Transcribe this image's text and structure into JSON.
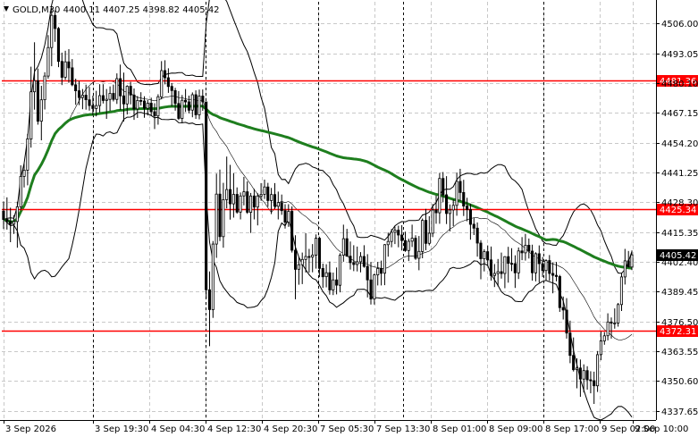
{
  "chart_data": {
    "type": "candlestick",
    "title": "GOLD,M30 4400.11 4407.25 4398.82 4405.42",
    "symbol": "GOLD",
    "timeframe": "M30",
    "last_bar": {
      "open": 4400.11,
      "high": 4407.25,
      "low": 4398.82,
      "close": 4405.42
    },
    "current_price_label": "4405.42",
    "ylim": [
      4333.6,
      4515.4
    ],
    "y_ticks": [
      "4506.00",
      "4493.05",
      "4480.10",
      "4467.15",
      "4454.20",
      "4441.25",
      "4428.30",
      "4415.35",
      "4402.40",
      "4389.45",
      "4376.50",
      "4363.55",
      "4350.60",
      "4337.65"
    ],
    "x_ticks": [
      "3 Sep 2026",
      "3 Sep 19:30",
      "4 Sep 04:30",
      "4 Sep 12:30",
      "4 Sep 20:30",
      "7 Sep 05:30",
      "7 Sep 13:30",
      "8 Sep 01:00",
      "8 Sep 09:00",
      "8 Sep 17:00",
      "9 Sep 02:00",
      "9 Sep 10:00"
    ],
    "levels": [
      {
        "value": 4481.36,
        "label": "4481.36",
        "color": "#ff0000"
      },
      {
        "value": 4425.34,
        "label": "4425.34",
        "color": "#ff0000"
      },
      {
        "value": 4372.31,
        "label": "4372.31",
        "color": "#ff0000"
      }
    ],
    "candles": [
      [
        4424.4,
        4428.6,
        4416.6,
        4420.8
      ],
      [
        4420.8,
        4430.4,
        4416.4,
        4419.9
      ],
      [
        4419.9,
        4425.9,
        4410.9,
        4418.7
      ],
      [
        4418.7,
        4422.6,
        4414.5,
        4419.9
      ],
      [
        4419.9,
        4428.5,
        4408.5,
        4426.3
      ],
      [
        4426.3,
        4444.3,
        4425.0,
        4439.5
      ],
      [
        4439.5,
        4445.3,
        4434.7,
        4442.2
      ],
      [
        4442.2,
        4458.0,
        4435.6,
        4455.8
      ],
      [
        4455.8,
        4487.2,
        4452.0,
        4476.3
      ],
      [
        4476.3,
        4497.8,
        4468.5,
        4481.1
      ],
      [
        4481.1,
        4486.4,
        4462.0,
        4463.5
      ],
      [
        4463.5,
        4478.9,
        4455.2,
        4472.8
      ],
      [
        4472.8,
        4484.8,
        4468.6,
        4483.1
      ],
      [
        4483.1,
        4500.9,
        4482.0,
        4495.5
      ],
      [
        4495.5,
        4512.6,
        4487.4,
        4509.5
      ],
      [
        4509.5,
        4511.6,
        4498.0,
        4503.8
      ],
      [
        4503.8,
        4504.4,
        4487.0,
        4489.5
      ],
      [
        4489.5,
        4493.3,
        4479.2,
        4482.6
      ],
      [
        4482.6,
        4494.1,
        4481.5,
        4489.3
      ],
      [
        4489.3,
        4494.8,
        4480.2,
        4486.7
      ],
      [
        4486.7,
        4490.5,
        4478.7,
        4479.3
      ],
      [
        4479.3,
        4482.0,
        4470.6,
        4476.7
      ],
      [
        4476.7,
        4480.9,
        4470.5,
        4473.8
      ],
      [
        4473.8,
        4477.5,
        4468.7,
        4474.8
      ],
      [
        4474.8,
        4479.4,
        4468.5,
        4472.8
      ],
      [
        4472.8,
        4478.4,
        4468.1,
        4470.3
      ],
      [
        4470.3,
        4474.6,
        4466.1,
        4469.0
      ],
      [
        4469.0,
        4476.7,
        4465.6,
        4470.3
      ],
      [
        4470.3,
        4479.6,
        4467.3,
        4474.6
      ],
      [
        4474.6,
        4479.6,
        4471.2,
        4472.5
      ],
      [
        4472.5,
        4477.5,
        4464.5,
        4473.0
      ],
      [
        4473.0,
        4478.6,
        4468.0,
        4475.6
      ],
      [
        4475.6,
        4479.4,
        4472.1,
        4473.0
      ],
      [
        4473.0,
        4484.3,
        4471.0,
        4482.0
      ],
      [
        4482.0,
        4488.1,
        4468.4,
        4474.5
      ],
      [
        4474.5,
        4484.6,
        4463.4,
        4471.0
      ],
      [
        4471.0,
        4479.1,
        4466.4,
        4478.7
      ],
      [
        4478.7,
        4480.6,
        4470.8,
        4474.9
      ],
      [
        4474.9,
        4477.7,
        4464.1,
        4468.8
      ],
      [
        4468.8,
        4474.4,
        4464.9,
        4472.5
      ],
      [
        4472.5,
        4476.1,
        4470.3,
        4472.3
      ],
      [
        4472.3,
        4474.3,
        4465.0,
        4469.1
      ],
      [
        4469.1,
        4472.7,
        4466.0,
        4471.3
      ],
      [
        4471.3,
        4473.7,
        4465.8,
        4467.6
      ],
      [
        4467.6,
        4471.3,
        4460.1,
        4465.8
      ],
      [
        4465.8,
        4475.2,
        4462.0,
        4474.1
      ],
      [
        4474.1,
        4489.6,
        4473.0,
        4485.5
      ],
      [
        4485.5,
        4490.0,
        4479.5,
        4482.4
      ],
      [
        4482.4,
        4486.5,
        4475.8,
        4478.6
      ],
      [
        4478.6,
        4480.1,
        4469.9,
        4476.8
      ],
      [
        4476.8,
        4478.0,
        4468.1,
        4471.2
      ],
      [
        4471.2,
        4476.6,
        4464.0,
        4464.7
      ],
      [
        4464.7,
        4474.9,
        4462.6,
        4472.6
      ],
      [
        4472.6,
        4477.5,
        4467.5,
        4471.9
      ],
      [
        4471.9,
        4474.6,
        4466.9,
        4468.3
      ],
      [
        4468.3,
        4476.0,
        4465.2,
        4475.0
      ],
      [
        4475.0,
        4476.9,
        4464.5,
        4466.3
      ],
      [
        4466.3,
        4477.2,
        4464.3,
        4474.4
      ],
      [
        4474.4,
        4477.3,
        4468.0,
        4471.9
      ],
      [
        4471.9,
        4413.5,
        4386.3,
        4390.2
      ],
      [
        4390.2,
        4398.2,
        4365.7,
        4381.6
      ],
      [
        4381.6,
        4411.4,
        4378.0,
        4410.1
      ],
      [
        4410.1,
        4440.7,
        4404.1,
        4431.8
      ],
      [
        4431.8,
        4442.5,
        4411.4,
        4413.3
      ],
      [
        4413.3,
        4436.7,
        4408.5,
        4429.4
      ],
      [
        4429.4,
        4448.1,
        4425.6,
        4433.8
      ],
      [
        4433.8,
        4444.5,
        4420.7,
        4427.6
      ],
      [
        4427.6,
        4440.9,
        4421.6,
        4431.7
      ],
      [
        4431.7,
        4434.7,
        4423.3,
        4424.0
      ],
      [
        4424.0,
        4432.5,
        4420.8,
        4431.0
      ],
      [
        4431.0,
        4439.3,
        4426.9,
        4432.8
      ],
      [
        4432.8,
        4437.3,
        4423.2,
        4423.9
      ],
      [
        4423.9,
        4432.3,
        4414.9,
        4431.0
      ],
      [
        4431.0,
        4434.1,
        4420.8,
        4426.2
      ],
      [
        4426.2,
        4432.2,
        4418.2,
        4431.0
      ],
      [
        4431.0,
        4436.6,
        4428.9,
        4431.7
      ],
      [
        4431.7,
        4438.1,
        4429.7,
        4434.9
      ],
      [
        4434.9,
        4436.7,
        4426.3,
        4429.0
      ],
      [
        4429.0,
        4434.5,
        4423.1,
        4431.6
      ],
      [
        4431.6,
        4436.6,
        4425.3,
        4426.5
      ],
      [
        4426.5,
        4432.9,
        4420.8,
        4428.1
      ],
      [
        4428.1,
        4431.6,
        4422.8,
        4424.6
      ],
      [
        4424.6,
        4427.4,
        4416.8,
        4419.6
      ],
      [
        4419.6,
        4427.4,
        4417.6,
        4424.3
      ],
      [
        4424.3,
        4426.5,
        4406.4,
        4407.4
      ],
      [
        4407.4,
        4413.9,
        4386.1,
        4399.1
      ],
      [
        4399.1,
        4404.5,
        4392.4,
        4401.1
      ],
      [
        4401.1,
        4406.4,
        4392.7,
        4403.4
      ],
      [
        4403.4,
        4414.8,
        4397.7,
        4404.7
      ],
      [
        4404.7,
        4408.0,
        4397.7,
        4404.4
      ],
      [
        4404.4,
        4410.1,
        4397.8,
        4405.3
      ],
      [
        4405.3,
        4414.3,
        4399.4,
        4412.6
      ],
      [
        4412.6,
        4413.3,
        4395.7,
        4399.5
      ],
      [
        4399.5,
        4401.6,
        4391.0,
        4395.9
      ],
      [
        4395.9,
        4401.3,
        4391.3,
        4397.6
      ],
      [
        4397.6,
        4402.5,
        4388.1,
        4390.1
      ],
      [
        4390.1,
        4397.7,
        4387.9,
        4394.5
      ],
      [
        4394.5,
        4399.9,
        4388.2,
        4392.2
      ],
      [
        4392.2,
        4406.1,
        4389.1,
        4405.2
      ],
      [
        4405.2,
        4418.5,
        4402.4,
        4412.4
      ],
      [
        4412.4,
        4416.7,
        4404.6,
        4404.8
      ],
      [
        4404.8,
        4411.2,
        4399.0,
        4402.0
      ],
      [
        4402.0,
        4409.6,
        4398.3,
        4401.2
      ],
      [
        4401.2,
        4409.0,
        4398.2,
        4402.4
      ],
      [
        4402.4,
        4406.6,
        4397.8,
        4404.7
      ],
      [
        4404.7,
        4409.6,
        4399.8,
        4400.4
      ],
      [
        4400.4,
        4405.7,
        4386.9,
        4394.5
      ],
      [
        4394.5,
        4402.3,
        4383.8,
        4386.2
      ],
      [
        4386.2,
        4397.2,
        4383.8,
        4396.7
      ],
      [
        4396.7,
        4402.3,
        4392.1,
        4399.5
      ],
      [
        4399.5,
        4402.9,
        4392.1,
        4397.4
      ],
      [
        4397.4,
        4410.1,
        4392.2,
        4409.8
      ],
      [
        4409.8,
        4415.1,
        4404.6,
        4411.2
      ],
      [
        4411.2,
        4416.6,
        4408.7,
        4415.2
      ],
      [
        4415.2,
        4417.7,
        4410.1,
        4416.1
      ],
      [
        4416.1,
        4418.1,
        4408.7,
        4414.0
      ],
      [
        4414.0,
        4418.3,
        4407.3,
        4411.6
      ],
      [
        4411.6,
        4415.5,
        4406.7,
        4407.3
      ],
      [
        4407.3,
        4412.4,
        4402.7,
        4411.3
      ],
      [
        4411.3,
        4418.5,
        4408.8,
        4412.6
      ],
      [
        4412.6,
        4413.9,
        4403.2,
        4403.9
      ],
      [
        4403.9,
        4413.6,
        4398.7,
        4406.9
      ],
      [
        4406.9,
        4421.2,
        4403.9,
        4420.4
      ],
      [
        4420.4,
        4425.4,
        4407.4,
        4410.4
      ],
      [
        4410.4,
        4422.2,
        4409.5,
        4414.8
      ],
      [
        4414.8,
        4427.5,
        4413.1,
        4424.9
      ],
      [
        4424.9,
        4431.2,
        4418.9,
        4423.7
      ],
      [
        4423.7,
        4441.0,
        4418.9,
        4438.6
      ],
      [
        4438.6,
        4441.4,
        4428.3,
        4431.5
      ],
      [
        4431.5,
        4439.6,
        4418.8,
        4423.4
      ],
      [
        4423.4,
        4427.3,
        4415.6,
        4424.9
      ],
      [
        4424.9,
        4429.5,
        4417.9,
        4426.9
      ],
      [
        4426.9,
        4441.2,
        4422.4,
        4437.3
      ],
      [
        4437.3,
        4442.8,
        4428.8,
        4432.5
      ],
      [
        4432.5,
        4438.0,
        4422.3,
        4426.6
      ],
      [
        4426.6,
        4430.2,
        4420.0,
        4425.1
      ],
      [
        4425.1,
        4427.6,
        4412.0,
        4418.7
      ],
      [
        4418.7,
        4421.4,
        4414.0,
        4417.0
      ],
      [
        4417.0,
        4419.5,
        4404.6,
        4410.5
      ],
      [
        4410.5,
        4411.8,
        4394.8,
        4403.7
      ],
      [
        4403.7,
        4407.8,
        4398.2,
        4406.8
      ],
      [
        4406.8,
        4409.5,
        4400.6,
        4403.2
      ],
      [
        4403.2,
        4409.0,
        4394.2,
        4396.4
      ],
      [
        4396.4,
        4401.4,
        4391.4,
        4397.3
      ],
      [
        4397.3,
        4403.6,
        4391.7,
        4398.1
      ],
      [
        4398.1,
        4406.4,
        4395.1,
        4397.3
      ],
      [
        4397.3,
        4404.8,
        4390.9,
        4404.6
      ],
      [
        4404.6,
        4408.9,
        4393.3,
        4401.7
      ],
      [
        4401.7,
        4408.3,
        4398.3,
        4401.6
      ],
      [
        4401.6,
        4405.2,
        4391.0,
        4397.6
      ],
      [
        4397.6,
        4408.6,
        4394.9,
        4407.1
      ],
      [
        4407.1,
        4413.1,
        4403.1,
        4406.3
      ],
      [
        4406.3,
        4414.5,
        4402.9,
        4409.6
      ],
      [
        4409.6,
        4412.5,
        4403.8,
        4407.0
      ],
      [
        4407.0,
        4409.8,
        4394.2,
        4397.6
      ],
      [
        4397.6,
        4406.5,
        4393.9,
        4405.9
      ],
      [
        4405.9,
        4409.5,
        4393.3,
        4401.6
      ],
      [
        4401.6,
        4404.5,
        4395.7,
        4398.6
      ],
      [
        4398.6,
        4403.5,
        4394.4,
        4402.9
      ],
      [
        4402.9,
        4405.3,
        4394.1,
        4397.3
      ],
      [
        4397.3,
        4402.1,
        4388.7,
        4396.5
      ],
      [
        4396.5,
        4402.3,
        4393.9,
        4396.0
      ],
      [
        4396.0,
        4396.7,
        4380.6,
        4382.5
      ],
      [
        4382.5,
        4387.3,
        4377.3,
        4381.4
      ],
      [
        4381.4,
        4386.6,
        4369.0,
        4371.4
      ],
      [
        4371.4,
        4376.8,
        4358.3,
        4361.7
      ],
      [
        4361.7,
        4369.5,
        4354.7,
        4355.5
      ],
      [
        4355.5,
        4360.4,
        4347.4,
        4356.2
      ],
      [
        4356.2,
        4359.9,
        4343.7,
        4351.4
      ],
      [
        4351.4,
        4357.8,
        4345.6,
        4355.1
      ],
      [
        4355.1,
        4357.0,
        4346.8,
        4351.1
      ],
      [
        4351.1,
        4354.8,
        4345.2,
        4350.7
      ],
      [
        4350.7,
        4354.6,
        4340.6,
        4348.5
      ],
      [
        4348.5,
        4363.6,
        4345.8,
        4362.0
      ],
      [
        4362.0,
        4372.1,
        4359.6,
        4368.0
      ],
      [
        4368.0,
        4371.8,
        4366.3,
        4370.2
      ],
      [
        4370.2,
        4380.0,
        4368.2,
        4376.2
      ],
      [
        4376.2,
        4378.2,
        4369.0,
        4375.7
      ],
      [
        4375.7,
        4382.1,
        4373.3,
        4375.8
      ],
      [
        4375.8,
        4384.5,
        4374.2,
        4383.8
      ],
      [
        4383.8,
        4397.7,
        4381.0,
        4395.8
      ],
      [
        4395.8,
        4408.0,
        4392.5,
        4402.8
      ],
      [
        4402.8,
        4407.1,
        4400.1,
        4400.1
      ],
      [
        4400.1,
        4407.3,
        4398.8,
        4405.4
      ]
    ]
  },
  "colors": {
    "background": "#ffffff",
    "candle": "#000000",
    "grid": "#c8c8c8",
    "ma": "#1e7e1e",
    "bands": "#000000",
    "level": "#ff0000",
    "price_label_bg": "#000000"
  }
}
